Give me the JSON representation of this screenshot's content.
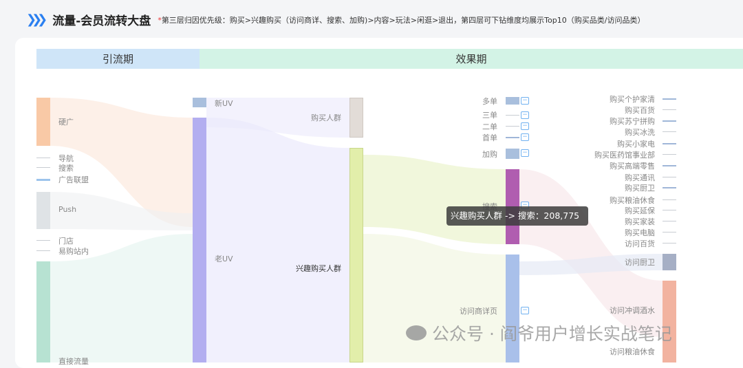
{
  "header": {
    "title": "流量-会员流转大盘",
    "note_mark": "*",
    "note": "第三层归因优先级：购买>兴趣购买（访问商详、搜索、加购)>内容>玩法>闲逛>退出，第四层可下钻维度均展示Top10（购买品类/访问品类）"
  },
  "phases": {
    "p1": "引流期",
    "p2": "效果期"
  },
  "col1": [
    "硬广",
    "导航",
    "搜索",
    "广告联盟",
    "Push",
    "门店",
    "易购站内",
    "直接流量"
  ],
  "col2": [
    "新UV",
    "老UV"
  ],
  "col3": [
    "购买人群",
    "兴趣购买人群"
  ],
  "col4": [
    "多单",
    "三单",
    "二单",
    "首单",
    "加购",
    "搜索",
    "访问商详页"
  ],
  "col4_collapse": "−",
  "col5": [
    "购买个护家清",
    "购买百货",
    "购买苏宁拼购",
    "购买冰洗",
    "购买小家电",
    "购买医药馆事业部",
    "购买高端零售",
    "购买通讯",
    "购买厨卫",
    "购买粮油休食",
    "购买延保",
    "购买家装",
    "购买电脑",
    "访问百货",
    "访问厨卫",
    "访问冲调酒水",
    "访问粮油休食"
  ],
  "tooltip": "兴趣购买人群 -> 搜索：208,775",
  "watermark": "公众号 · 阎爷用户增长实战笔记",
  "colors": {
    "accent": "#2a7ff0",
    "band1": "#cfe5f8",
    "band2": "#d3f3e6"
  }
}
